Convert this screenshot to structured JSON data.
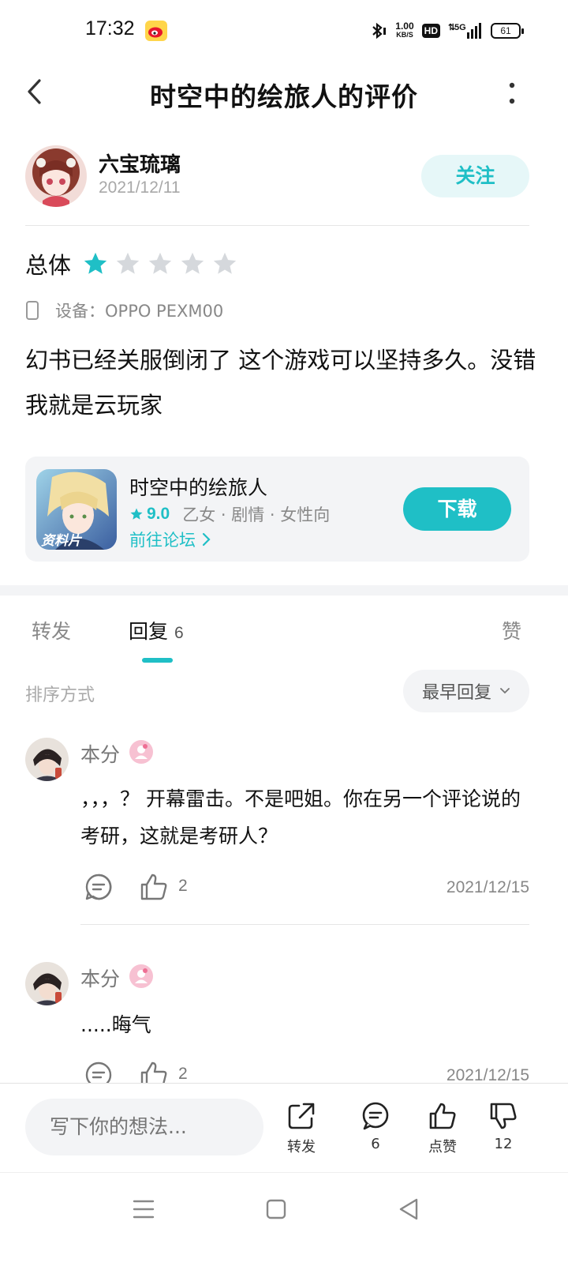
{
  "status_bar": {
    "time": "17:32",
    "speed_value": "1.00",
    "speed_unit": "KB/S",
    "hd": "HD",
    "network": "5G",
    "battery": "61"
  },
  "header": {
    "title": "时空中的绘旅人的评价"
  },
  "author": {
    "name": "六宝琉璃",
    "date": "2021/12/11",
    "follow_label": "关注"
  },
  "rating": {
    "label": "总体",
    "stars": 1,
    "max_stars": 5,
    "device_label": "设备：OPPO PEXM00"
  },
  "review": {
    "text": "幻书已经关服倒闭了 这个游戏可以坚持多久。没错我就是云玩家"
  },
  "app_card": {
    "name": "时空中的绘旅人",
    "score": "9.0",
    "tags": "乙女 · 剧情 · 女性向",
    "forum_link": "前往论坛",
    "download_label": "下载",
    "icon_text": "资料片"
  },
  "tabs": {
    "forward": "转发",
    "reply": "回复",
    "reply_count": "6",
    "like": "赞"
  },
  "sort": {
    "label": "排序方式",
    "selected": "最早回复"
  },
  "comments": [
    {
      "name": "本分",
      "text": "，，，？ 开幕雷击。不是吧姐。你在另一个评论说的考研，这就是考研人？",
      "likes": "2",
      "date": "2021/12/15"
    },
    {
      "name": "本分",
      "text": ".....晦气",
      "likes": "2",
      "date": "2021/12/15"
    }
  ],
  "bottom_bar": {
    "input_placeholder": "写下你的想法...",
    "forward_label": "转发",
    "comment_count": "6",
    "like_label": "点赞",
    "dislike_count": "12"
  },
  "colors": {
    "accent": "#1fbfc6",
    "star_inactive": "#d5d8dc",
    "panel_bg": "#f3f4f6"
  }
}
